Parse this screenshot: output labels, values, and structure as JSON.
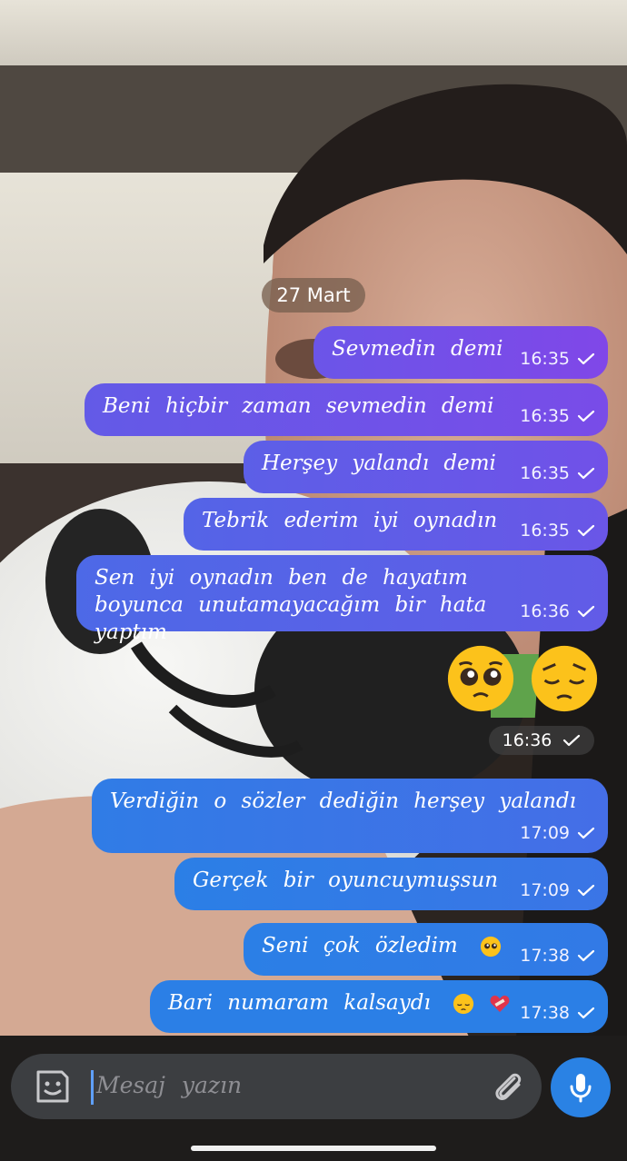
{
  "chat": {
    "date_label": "27 Mart",
    "messages": [
      {
        "text": "Sevmedin demi",
        "time": "16:35"
      },
      {
        "text": "Beni hiçbir zaman sevmedin demi",
        "time": "16:35"
      },
      {
        "text": "Herşey yalandı demi",
        "time": "16:35"
      },
      {
        "text": "Tebrik ederim iyi oynadın",
        "time": "16:35"
      },
      {
        "text": "Sen iyi oynadın ben de hayatım boyunca unutamayacağım bir hata yaptım",
        "time": "16:36"
      },
      {
        "text": "Verdiğin o sözler dediğin herşey yalandı",
        "time": "17:09"
      },
      {
        "text": "Gerçek bir oyuncuymuşsun",
        "time": "17:09"
      },
      {
        "text": "Seni çok özledim",
        "time": "17:38",
        "emoji": [
          "pleading-face"
        ]
      },
      {
        "text": "Bari numaram kalsaydı",
        "time": "17:38",
        "emoji": [
          "pensive-face",
          "mending-heart"
        ]
      }
    ],
    "emoji_message": {
      "emoji": [
        "pleading-face",
        "pensive-face"
      ],
      "time": "16:36"
    }
  },
  "composer": {
    "placeholder": "Mesaj yazın",
    "icons": [
      "sticker-icon",
      "attach-icon",
      "mic-icon"
    ]
  },
  "colors": {
    "bubble_gradient": [
      "#8047e8",
      "#2b7fe6"
    ],
    "date_chip": "#7a6252",
    "input_bar": "#3c3e41",
    "mic_button": "#2a82e4"
  }
}
